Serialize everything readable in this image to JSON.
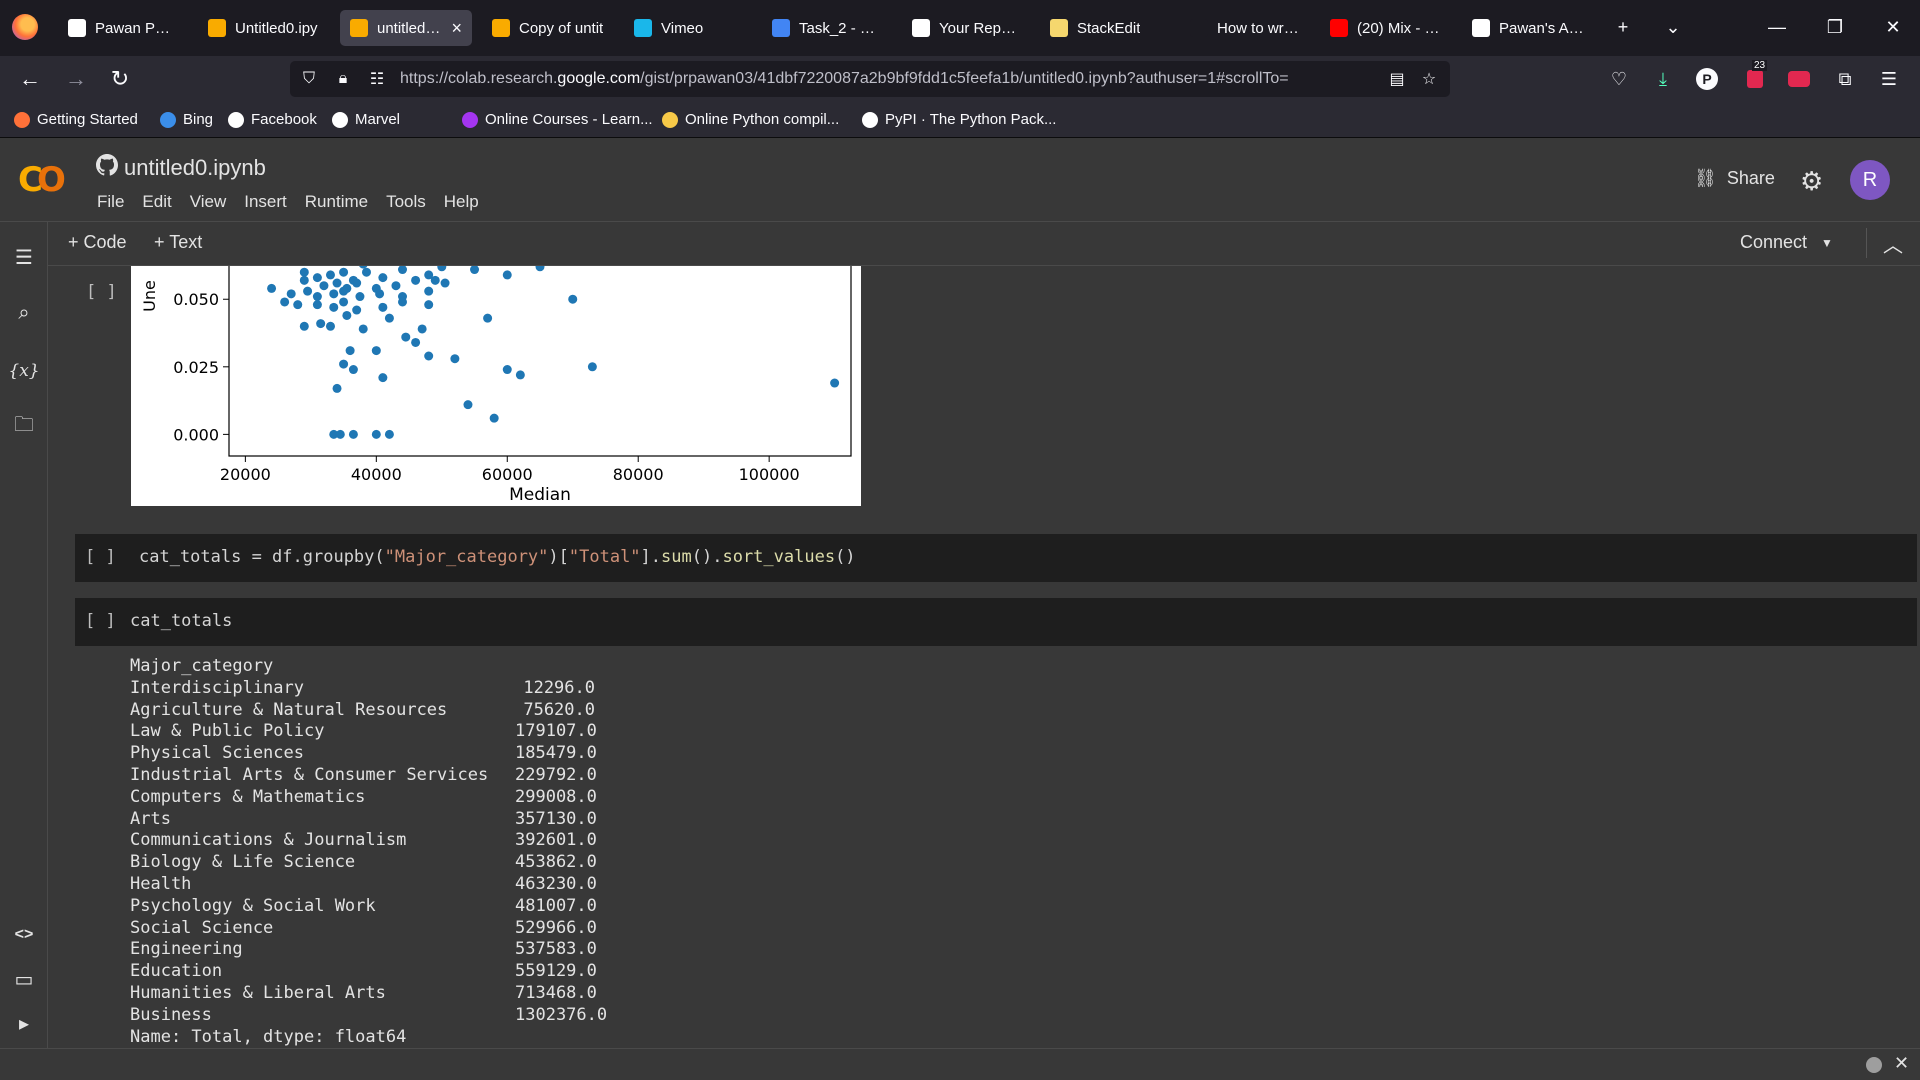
{
  "browser": {
    "tabs": [
      {
        "label": "Pawan PR's P",
        "icon": "gist-icon",
        "color": "#ffffff"
      },
      {
        "label": "Untitled0.ipy",
        "icon": "colab-icon",
        "color": "#f9ab00"
      },
      {
        "label": "untitled0.ip",
        "icon": "colab-icon",
        "color": "#f9ab00",
        "active": true
      },
      {
        "label": "Copy of untit",
        "icon": "colab-icon",
        "color": "#f9ab00"
      },
      {
        "label": "Vimeo",
        "icon": "vimeo-icon",
        "color": "#1ab7ea"
      },
      {
        "label": "Task_2 - Goo",
        "icon": "docs-icon",
        "color": "#4285f4"
      },
      {
        "label": "Your Reposito",
        "icon": "github-icon",
        "color": "#ffffff"
      },
      {
        "label": "StackEdit",
        "icon": "stackedit-icon",
        "color": "#f5d76e"
      },
      {
        "label": "How to write ? |",
        "icon": "blank-icon",
        "color": "#1c1b22"
      },
      {
        "label": "(20) Mix - Bo",
        "icon": "youtube-icon",
        "color": "#ff0000"
      },
      {
        "label": "Pawan's AI-M",
        "icon": "gist-icon",
        "color": "#ffffff"
      }
    ],
    "url_prefix": "https://colab.research.",
    "url_domain": "google.com",
    "url_suffix": "/gist/prpawan03/41dbf7220087a2b9bf9fdd1c5feefa1b/untitled0.ipynb?authuser=1#scrollTo=",
    "badge_count": "23",
    "profile_initial": "P",
    "bookmarks": [
      {
        "label": "Getting Started",
        "color": "#ff7139"
      },
      {
        "label": "Bing",
        "color": "#3b8eea"
      },
      {
        "label": "Facebook",
        "color": "#ffffff"
      },
      {
        "label": "Marvel",
        "color": "#ffffff"
      },
      {
        "label": "Online Courses - Learn...",
        "color": "#a435f0"
      },
      {
        "label": "Online Python compil...",
        "color": "#f7c948"
      },
      {
        "label": "PyPI · The Python Pack...",
        "color": "#ffffff"
      }
    ]
  },
  "colab": {
    "notebook_title": "untitled0.ipynb",
    "menu": [
      "File",
      "Edit",
      "View",
      "Insert",
      "Runtime",
      "Tools",
      "Help"
    ],
    "share_label": "Share",
    "avatar_initial": "R",
    "add_code_label": "+ Code",
    "add_text_label": "+ Text",
    "connect_label": "Connect",
    "run_bracket": "[ ]"
  },
  "chart_data": {
    "type": "scatter",
    "xlabel": "Median",
    "ylabel": "Une",
    "xticks": [
      "20000",
      "40000",
      "60000",
      "80000",
      "100000"
    ],
    "yticks": [
      "0.000",
      "0.025",
      "0.050"
    ],
    "xlim": [
      17500,
      112500
    ],
    "ylim": [
      -0.008,
      0.066
    ],
    "color": "#1f77b4",
    "points": [
      [
        25000,
        0.064
      ],
      [
        30000,
        0.065
      ],
      [
        34000,
        0.064
      ],
      [
        38000,
        0.063
      ],
      [
        45000,
        0.064
      ],
      [
        53000,
        0.065
      ],
      [
        60000,
        0.065
      ],
      [
        65000,
        0.062
      ],
      [
        29000,
        0.06
      ],
      [
        31000,
        0.058
      ],
      [
        33000,
        0.059
      ],
      [
        35000,
        0.06
      ],
      [
        36500,
        0.057
      ],
      [
        38500,
        0.06
      ],
      [
        41000,
        0.058
      ],
      [
        44000,
        0.061
      ],
      [
        48000,
        0.059
      ],
      [
        50000,
        0.062
      ],
      [
        55000,
        0.061
      ],
      [
        60000,
        0.059
      ],
      [
        29000,
        0.057
      ],
      [
        32000,
        0.055
      ],
      [
        34000,
        0.056
      ],
      [
        35500,
        0.054
      ],
      [
        37000,
        0.056
      ],
      [
        40000,
        0.054
      ],
      [
        43000,
        0.055
      ],
      [
        46000,
        0.057
      ],
      [
        49000,
        0.057
      ],
      [
        50500,
        0.056
      ],
      [
        24000,
        0.054
      ],
      [
        27000,
        0.052
      ],
      [
        29500,
        0.053
      ],
      [
        31000,
        0.051
      ],
      [
        33500,
        0.052
      ],
      [
        35000,
        0.053
      ],
      [
        37500,
        0.051
      ],
      [
        40500,
        0.052
      ],
      [
        44000,
        0.051
      ],
      [
        48000,
        0.053
      ],
      [
        70000,
        0.05
      ],
      [
        26000,
        0.049
      ],
      [
        28000,
        0.048
      ],
      [
        31000,
        0.048
      ],
      [
        33500,
        0.047
      ],
      [
        35000,
        0.049
      ],
      [
        37000,
        0.046
      ],
      [
        41000,
        0.047
      ],
      [
        44000,
        0.049
      ],
      [
        48000,
        0.048
      ],
      [
        57000,
        0.043
      ],
      [
        29000,
        0.04
      ],
      [
        31500,
        0.041
      ],
      [
        33000,
        0.04
      ],
      [
        35500,
        0.044
      ],
      [
        38000,
        0.039
      ],
      [
        42000,
        0.043
      ],
      [
        44500,
        0.036
      ],
      [
        47000,
        0.039
      ],
      [
        36000,
        0.031
      ],
      [
        40000,
        0.031
      ],
      [
        46000,
        0.034
      ],
      [
        48000,
        0.029
      ],
      [
        52000,
        0.028
      ],
      [
        35000,
        0.026
      ],
      [
        36500,
        0.024
      ],
      [
        41000,
        0.021
      ],
      [
        60000,
        0.024
      ],
      [
        62000,
        0.022
      ],
      [
        73000,
        0.025
      ],
      [
        34000,
        0.017
      ],
      [
        54000,
        0.011
      ],
      [
        58000,
        0.006
      ],
      [
        110000,
        0.019
      ],
      [
        33500,
        0.0
      ],
      [
        34500,
        0.0
      ],
      [
        36500,
        0.0
      ],
      [
        40000,
        0.0
      ],
      [
        42000,
        0.0
      ]
    ]
  },
  "cells": {
    "groupby_code": {
      "pre": "cat_totals = df.groupby(",
      "arg1": "\"Major_category\"",
      "mid": ")[",
      "arg2": "\"Total\"",
      "post": "].",
      "fn1": "sum",
      "mid2": "().",
      "fn2": "sort_values",
      "end": "()"
    },
    "display_code": "cat_totals"
  },
  "output": {
    "index_name": "Major_category",
    "rows": [
      {
        "k": "Interdisciplinary",
        "v": "12296.0"
      },
      {
        "k": "Agriculture & Natural Resources",
        "v": "75620.0"
      },
      {
        "k": "Law & Public Policy",
        "v": "179107.0"
      },
      {
        "k": "Physical Sciences",
        "v": "185479.0"
      },
      {
        "k": "Industrial Arts & Consumer Services",
        "v": "229792.0"
      },
      {
        "k": "Computers & Mathematics",
        "v": "299008.0"
      },
      {
        "k": "Arts",
        "v": "357130.0"
      },
      {
        "k": "Communications & Journalism",
        "v": "392601.0"
      },
      {
        "k": "Biology & Life Science",
        "v": "453862.0"
      },
      {
        "k": "Health",
        "v": "463230.0"
      },
      {
        "k": "Psychology & Social Work",
        "v": "481007.0"
      },
      {
        "k": "Social Science",
        "v": "529966.0"
      },
      {
        "k": "Engineering",
        "v": "537583.0"
      },
      {
        "k": "Education",
        "v": "559129.0"
      },
      {
        "k": "Humanities & Liberal Arts",
        "v": "713468.0"
      },
      {
        "k": "Business",
        "v": "1302376.0"
      }
    ],
    "footer": "Name: Total, dtype: float64"
  }
}
